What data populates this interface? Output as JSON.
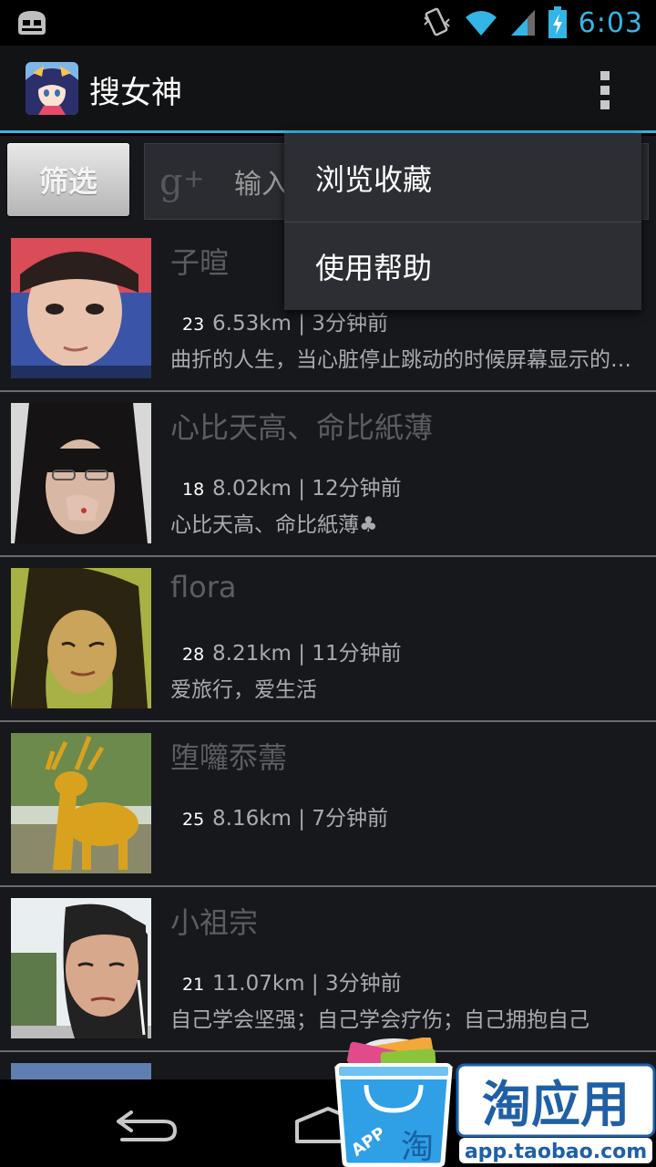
{
  "status_bar": {
    "time": "6:03"
  },
  "action_bar": {
    "title": "搜女神"
  },
  "toolbar": {
    "filter_label": "筛选",
    "search_placeholder": "输入"
  },
  "menu": {
    "items": [
      "浏览收藏",
      "使用帮助"
    ]
  },
  "list": [
    {
      "name": "子暄",
      "age": "23",
      "meta": "6.53km | 3分钟前",
      "signature": "曲折的人生，当心脏停止跳动的时候屏幕显示的是一条直线"
    },
    {
      "name": "心比天高、命比紙薄",
      "age": "18",
      "meta": "8.02km | 12分钟前",
      "signature": "心比天高、命比紙薄♣"
    },
    {
      "name": "flora",
      "age": "28",
      "meta": "8.21km | 11分钟前",
      "signature": "爱旅行，爱生活"
    },
    {
      "name": "堕囖忝薷",
      "age": "25",
      "meta": "8.16km | 7分钟前",
      "signature": ""
    },
    {
      "name": "小祖宗",
      "age": "21",
      "meta": "11.07km | 3分钟前",
      "signature": "自己学会坚强；自己学会疗伤；自己拥抱自己"
    }
  ],
  "watermark": {
    "brand": "淘应用",
    "url": "app.taobao.com",
    "badge": "APP",
    "bag_char": "淘"
  },
  "colors": {
    "accent": "#33b5e5",
    "background": "#17181c",
    "menu_bg": "#2c2e33"
  }
}
